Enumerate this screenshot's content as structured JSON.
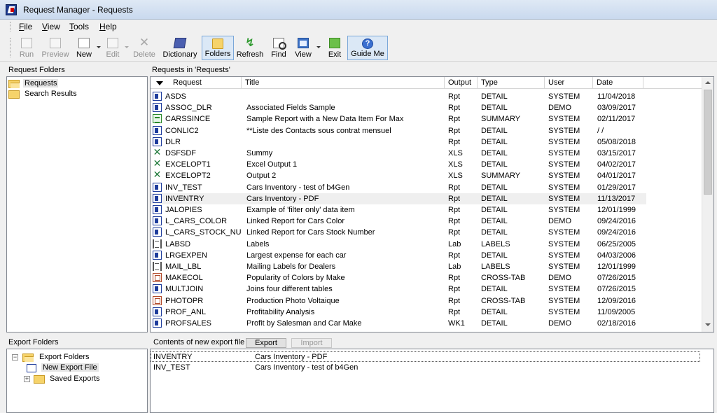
{
  "window": {
    "title": "Request Manager - Requests",
    "app_icon": "request-manager-app-icon"
  },
  "menu": [
    {
      "label": "File",
      "mnemonic": "F",
      "rest": "ile"
    },
    {
      "label": "View",
      "mnemonic": "V",
      "rest": "iew"
    },
    {
      "label": "Tools",
      "mnemonic": "T",
      "rest": "ools"
    },
    {
      "label": "Help",
      "mnemonic": "H",
      "rest": "elp"
    }
  ],
  "toolbar": {
    "run": "Run",
    "preview": "Preview",
    "new": "New",
    "edit": "Edit",
    "delete": "Delete",
    "dictionary": "Dictionary",
    "folders": "Folders",
    "refresh": "Refresh",
    "find": "Find",
    "view": "View",
    "exit": "Exit",
    "guide_me": "Guide Me"
  },
  "request_folders": {
    "header": "Request Folders",
    "items": [
      "Requests",
      "Search Results"
    ]
  },
  "requests_list": {
    "header": "Requests in 'Requests'",
    "columns": [
      "Request",
      "Title",
      "Output",
      "Type",
      "User",
      "Date"
    ],
    "rows": [
      {
        "icon": "rpt",
        "request": "ASDS",
        "title": "",
        "output": "Rpt",
        "type": "DETAIL",
        "user": "SYSTEM",
        "date": "11/04/2018"
      },
      {
        "icon": "rpt",
        "request": "ASSOC_DLR",
        "title": "Associated Fields Sample",
        "output": "Rpt",
        "type": "DETAIL",
        "user": "DEMO",
        "date": "03/09/2017"
      },
      {
        "icon": "sum",
        "request": "CARSSINCE",
        "title": "Sample Report with a New Data Item For Max",
        "output": "Rpt",
        "type": "SUMMARY",
        "user": "SYSTEM",
        "date": "02/11/2017"
      },
      {
        "icon": "rpt",
        "request": "CONLIC2",
        "title": "**Liste des Contacts sous contrat mensuel",
        "output": "Rpt",
        "type": "DETAIL",
        "user": "SYSTEM",
        "date": "  /  /"
      },
      {
        "icon": "rpt",
        "request": "DLR",
        "title": "",
        "output": "Rpt",
        "type": "DETAIL",
        "user": "SYSTEM",
        "date": "05/08/2018"
      },
      {
        "icon": "xls",
        "request": "DSFSDF",
        "title": "Summy",
        "output": "XLS",
        "type": "DETAIL",
        "user": "SYSTEM",
        "date": "03/15/2017"
      },
      {
        "icon": "xls",
        "request": "EXCELOPT1",
        "title": "Excel Output 1",
        "output": "XLS",
        "type": "DETAIL",
        "user": "SYSTEM",
        "date": "04/02/2017"
      },
      {
        "icon": "xls",
        "request": "EXCELOPT2",
        "title": "Output 2",
        "output": "XLS",
        "type": "SUMMARY",
        "user": "SYSTEM",
        "date": "04/01/2017"
      },
      {
        "icon": "rpt",
        "request": "INV_TEST",
        "title": "Cars Inventory - test of b4Gen",
        "output": "Rpt",
        "type": "DETAIL",
        "user": "SYSTEM",
        "date": "01/29/2017"
      },
      {
        "icon": "rpt",
        "request": "INVENTRY",
        "title": "Cars Inventory - PDF",
        "output": "Rpt",
        "type": "DETAIL",
        "user": "SYSTEM",
        "date": "11/13/2017",
        "highlight": true
      },
      {
        "icon": "rpt",
        "request": "JALOPIES",
        "title": "Example of 'filter only' data item",
        "output": "Rpt",
        "type": "DETAIL",
        "user": "SYSTEM",
        "date": "12/01/1999"
      },
      {
        "icon": "rpt",
        "request": "L_CARS_COLOR",
        "title": "Linked Report for Cars Color",
        "output": "Rpt",
        "type": "DETAIL",
        "user": "DEMO",
        "date": "09/24/2016"
      },
      {
        "icon": "rpt",
        "request": "L_CARS_STOCK_NU",
        "title": "Linked Report for Cars Stock Number",
        "output": "Rpt",
        "type": "DETAIL",
        "user": "SYSTEM",
        "date": "09/24/2016"
      },
      {
        "icon": "lab",
        "request": "LABSD",
        "title": "Labels",
        "output": "Lab",
        "type": "LABELS",
        "user": "SYSTEM",
        "date": "06/25/2005"
      },
      {
        "icon": "rpt",
        "request": "LRGEXPEN",
        "title": "Largest expense for each car",
        "output": "Rpt",
        "type": "DETAIL",
        "user": "SYSTEM",
        "date": "04/03/2006"
      },
      {
        "icon": "lab",
        "request": "MAIL_LBL",
        "title": "Mailing Labels for Dealers",
        "output": "Lab",
        "type": "LABELS",
        "user": "SYSTEM",
        "date": "12/01/1999"
      },
      {
        "icon": "ct",
        "request": "MAKECOL",
        "title": "Popularity of Colors by Make",
        "output": "Rpt",
        "type": "CROSS-TAB",
        "user": "DEMO",
        "date": "07/26/2015"
      },
      {
        "icon": "rpt",
        "request": "MULTJOIN",
        "title": "Joins four different tables",
        "output": "Rpt",
        "type": "DETAIL",
        "user": "SYSTEM",
        "date": "07/26/2015"
      },
      {
        "icon": "ct",
        "request": "PHOTOPR",
        "title": "Production Photo Voltaique",
        "output": "Rpt",
        "type": "CROSS-TAB",
        "user": "SYSTEM",
        "date": "12/09/2016"
      },
      {
        "icon": "rpt",
        "request": "PROF_ANL",
        "title": "Profitability Analysis",
        "output": "Rpt",
        "type": "DETAIL",
        "user": "SYSTEM",
        "date": "11/09/2005"
      },
      {
        "icon": "rpt",
        "request": "PROFSALES",
        "title": "Profit by Salesman and Car Make",
        "output": "WK1",
        "type": "DETAIL",
        "user": "DEMO",
        "date": "02/18/2016"
      }
    ]
  },
  "export_folders": {
    "header": "Export Folders",
    "root": "Export Folders",
    "items": [
      "New Export File",
      "Saved Exports"
    ]
  },
  "export_contents": {
    "header": "Contents of new export file",
    "export_button": "Export",
    "import_button": "Import",
    "rows": [
      {
        "request": "INVENTRY",
        "title": "Cars Inventory - PDF"
      },
      {
        "request": "INV_TEST",
        "title": "Cars Inventory - test of b4Gen"
      }
    ]
  }
}
